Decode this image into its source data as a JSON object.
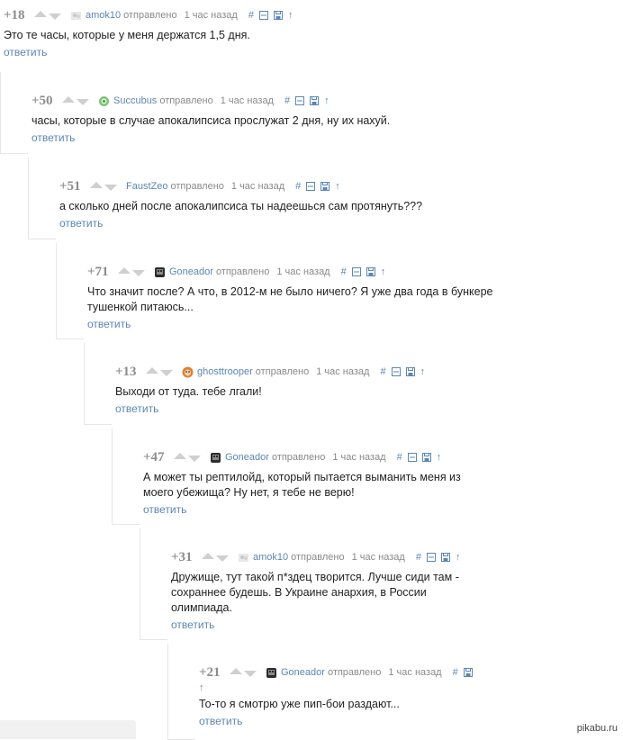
{
  "common": {
    "sent_label": "отправлено",
    "time_label": "1 час назад",
    "reply_label": "ответить",
    "tool_link": "#",
    "tool_arrow": "↑"
  },
  "comments": [
    {
      "rating": "+18",
      "author": "amok10",
      "avatar": "bw-avatar-icon",
      "text": "Это те часы, которые у меня держатся 1,5 дня."
    },
    {
      "rating": "+50",
      "author": "Succubus",
      "avatar": "green-avatar-icon",
      "text": "часы, которые в случае апокалипсиса прослужат 2 дня, ну их нахуй."
    },
    {
      "rating": "+51",
      "author": "FaustZeo",
      "avatar": "none",
      "text": "а сколько дней после апокалипсиса ты надеешься сам протянуть???"
    },
    {
      "rating": "+71",
      "author": "Goneador",
      "avatar": "dark-avatar-icon",
      "text": "Что значит после? А что, в 2012-м не было ничего? Я уже два года в бункере тушенкой питаюсь..."
    },
    {
      "rating": "+13",
      "author": "ghosttrooper",
      "avatar": "orange-avatar-icon",
      "text": "Выходи от туда. тебе лгали!"
    },
    {
      "rating": "+47",
      "author": "Goneador",
      "avatar": "dark-avatar-icon",
      "text": "А может ты рептилойд, который пытается выманить меня из моего убежища? Ну нет, я тебе не верю!"
    },
    {
      "rating": "+31",
      "author": "amok10",
      "avatar": "bw-avatar-icon",
      "text": "Дружище, тут такой п*здец творится. Лучше сиди там - сохраннее будешь. В Украине анархия, в России олимпиада."
    },
    {
      "rating": "+21",
      "author": "Goneador",
      "avatar": "dark-avatar-icon",
      "text": "То-то я смотрю уже пип-бои раздают..."
    }
  ],
  "watermark": "pikabu.ru",
  "colors": {
    "link": "#5b86b5",
    "rating": "#8c8c8c",
    "vote": "#cfcfcf",
    "guide": "#e6e6e6"
  }
}
